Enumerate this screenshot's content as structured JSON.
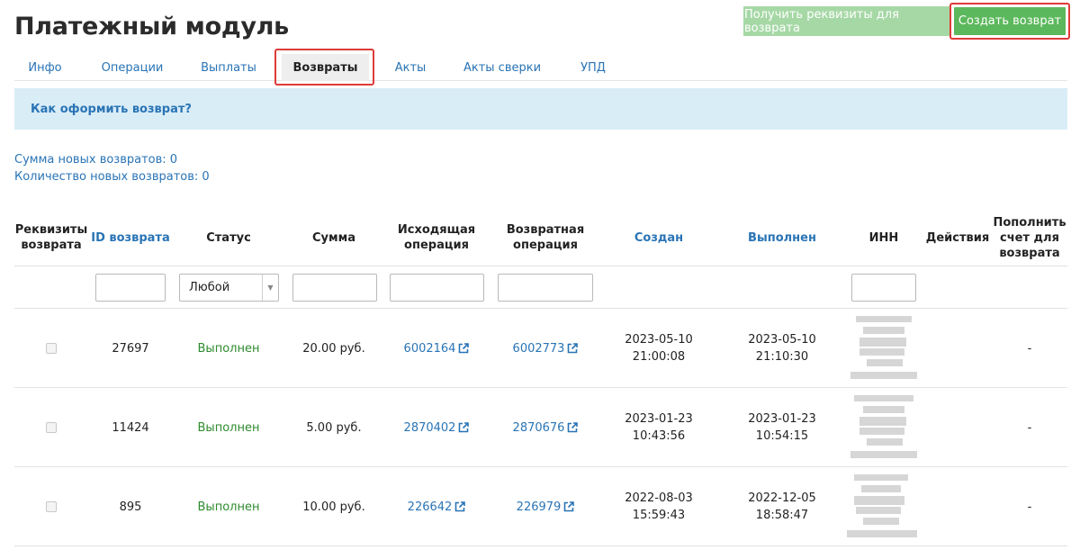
{
  "header": {
    "title": "Платежный модуль",
    "btn_refund_details": "Получить реквизиты для возврата",
    "btn_create_refund": "Создать возврат"
  },
  "tabs": [
    {
      "label": "Инфо"
    },
    {
      "label": "Операции"
    },
    {
      "label": "Выплаты"
    },
    {
      "label": "Возвраты",
      "active": true
    },
    {
      "label": "Акты"
    },
    {
      "label": "Акты сверки"
    },
    {
      "label": "УПД"
    }
  ],
  "info_banner": {
    "link": "Как оформить возврат?"
  },
  "summary": {
    "sum_new": "Сумма новых возвратов: 0",
    "count_new": "Количество новых возвратов: 0"
  },
  "table": {
    "columns": [
      {
        "label": "Реквизиты возврата",
        "sortable": false
      },
      {
        "label": "ID возврата",
        "sortable": true
      },
      {
        "label": "Статус",
        "sortable": false
      },
      {
        "label": "Сумма",
        "sortable": false
      },
      {
        "label": "Исходящая операция",
        "sortable": false
      },
      {
        "label": "Возвратная операция",
        "sortable": false
      },
      {
        "label": "Создан",
        "sortable": true
      },
      {
        "label": "Выполнен",
        "sortable": true
      },
      {
        "label": "ИНН",
        "sortable": false
      },
      {
        "label": "Действия",
        "sortable": false
      },
      {
        "label": "Пополнить счет для возврата",
        "sortable": false
      }
    ],
    "status_filter": "Любой",
    "rows": [
      {
        "id": "27697",
        "status": "Выполнен",
        "amount": "20.00 руб.",
        "outgoing_op": "6002164",
        "refund_op": "6002773",
        "created_date": "2023-05-10",
        "created_time": "21:00:08",
        "completed": "2023-05-10 21:10:30",
        "topup": "-"
      },
      {
        "id": "11424",
        "status": "Выполнен",
        "amount": "5.00 руб.",
        "outgoing_op": "2870402",
        "refund_op": "2870676",
        "created_date": "2023-01-23",
        "created_time": "10:43:56",
        "completed": "2023-01-23 10:54:15",
        "topup": "-"
      },
      {
        "id": "895",
        "status": "Выполнен",
        "amount": "10.00 руб.",
        "outgoing_op": "226642",
        "refund_op": "226979",
        "created_date": "2022-08-03",
        "created_time": "15:59:43",
        "completed": "2022-12-05 18:58:47",
        "topup": "-"
      }
    ]
  },
  "colors": {
    "accent": "#2a74b5",
    "success": "#5cb85c",
    "status_done": "#2e8b2e",
    "highlight": "#e03a3a",
    "banner": "#d9edf7"
  }
}
